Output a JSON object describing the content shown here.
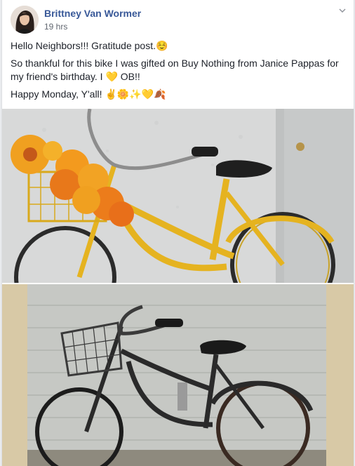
{
  "post": {
    "author": "Brittney Van Wormer",
    "timestamp": "19 hrs",
    "lines": [
      "Hello Neighbors!!! Gratitude post.☺️",
      "So thankful for this bike I was gifted on Buy Nothing from Janice Pappas for my friend's birthday. I 💛 OB!!",
      "Happy Monday, Y'all! ✌️🌼✨💛🍂"
    ]
  },
  "icons": {
    "menu": "chevron-down-icon",
    "avatar": "profile-photo"
  },
  "colors": {
    "author_link": "#385898",
    "timestamp": "#616770",
    "bike_new": "#e5b320",
    "bike_old": "#2a2a2a"
  }
}
